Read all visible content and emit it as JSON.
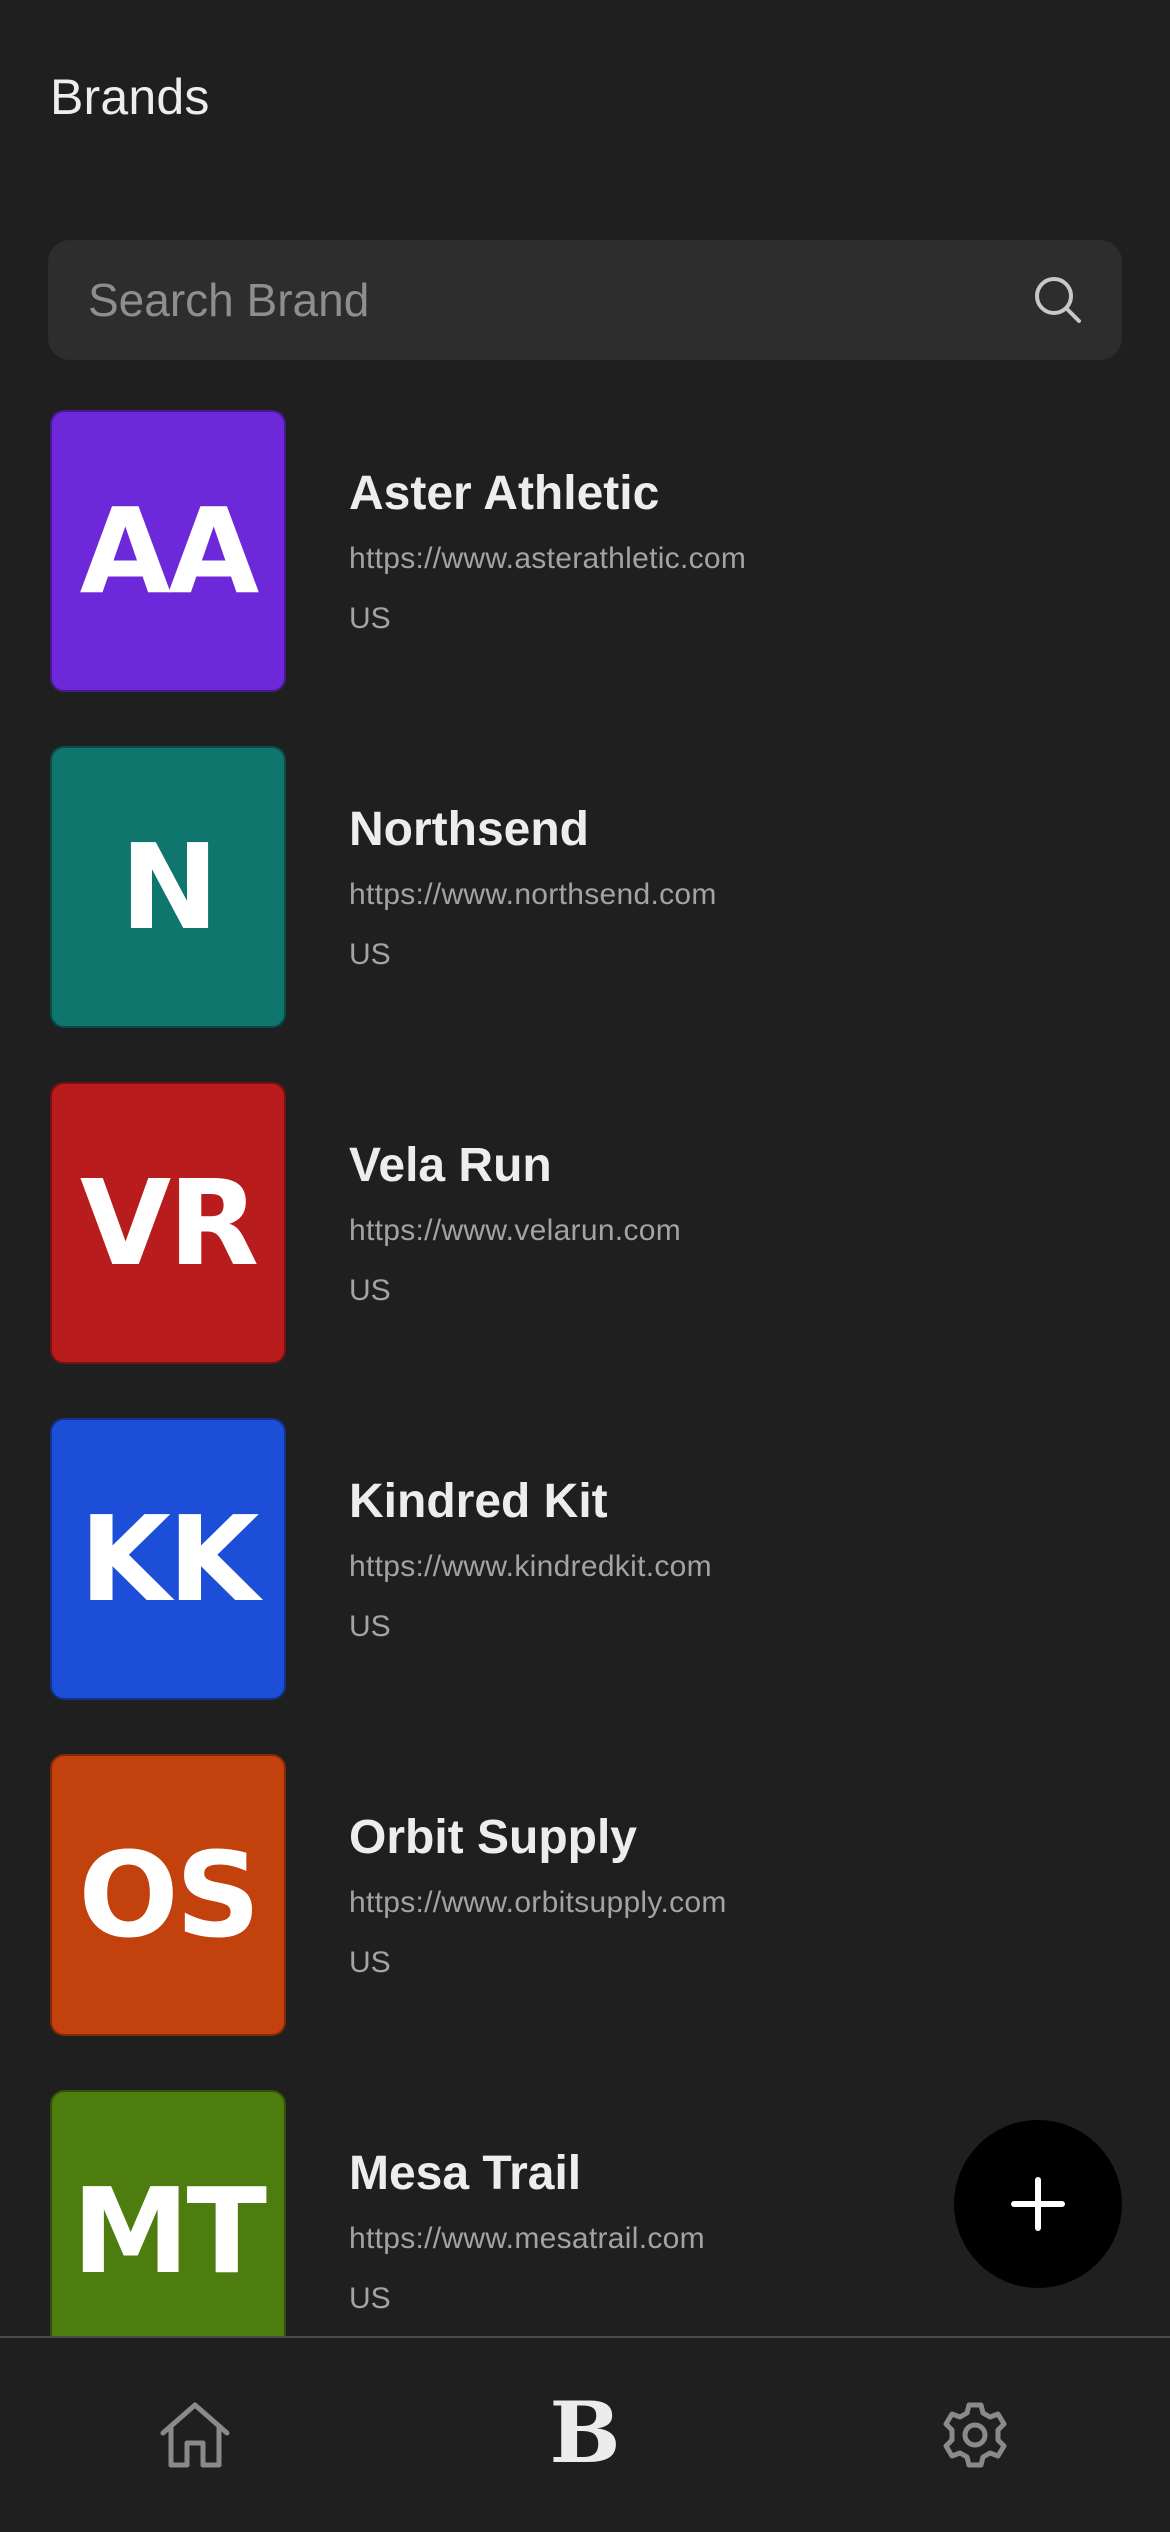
{
  "header": {
    "title": "Brands"
  },
  "search": {
    "placeholder": "Search Brand",
    "value": "",
    "icon": "search-icon"
  },
  "brands": [
    {
      "initials": "AA",
      "name": "Aster Athletic",
      "url": "https://www.asterathletic.com",
      "country": "US",
      "color": "#6d28d9"
    },
    {
      "initials": "N",
      "name": "Northsend",
      "url": "https://www.northsend.com",
      "country": "US",
      "color": "#0f766e"
    },
    {
      "initials": "VR",
      "name": "Vela Run",
      "url": "https://www.velarun.com",
      "country": "US",
      "color": "#b91c1c"
    },
    {
      "initials": "KK",
      "name": "Kindred Kit",
      "url": "https://www.kindredkit.com",
      "country": "US",
      "color": "#1d4ed8"
    },
    {
      "initials": "OS",
      "name": "Orbit Supply",
      "url": "https://www.orbitsupply.com",
      "country": "US",
      "color": "#c2410c"
    },
    {
      "initials": "MT",
      "name": "Mesa Trail",
      "url": "https://www.mesatrail.com",
      "country": "US",
      "color": "#4d7c0f"
    }
  ],
  "fab": {
    "icon": "plus-icon"
  },
  "bottom_nav": {
    "home_icon": "home-icon",
    "brands_label": "B",
    "settings_icon": "gear-icon"
  }
}
